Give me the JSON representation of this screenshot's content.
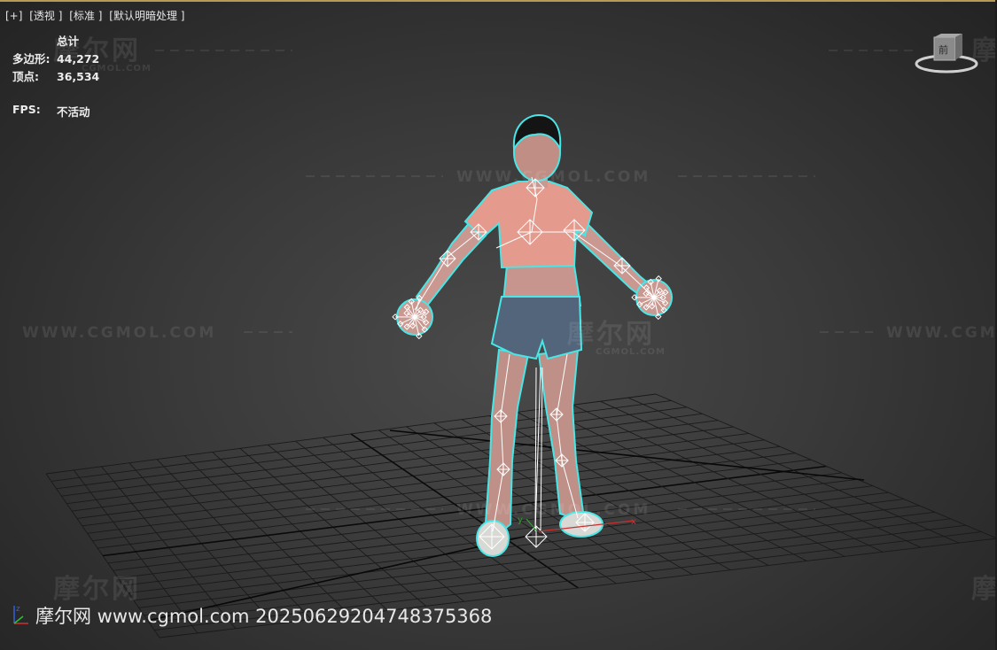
{
  "viewport": {
    "label_plus": "[+]",
    "label_view": "[透视 ]",
    "label_shading": "[标准 ]",
    "label_lighting": "[默认明暗处理 ]"
  },
  "stats": {
    "header": "总计",
    "polygons_label": "多边形:",
    "polygons_value": "44,272",
    "vertices_label": "顶点:",
    "vertices_value": "36,534",
    "fps_label": "FPS:",
    "fps_value": "不活动"
  },
  "watermarks": {
    "url": "WWW.CGMOL.COM",
    "url_short": "WWW.CGM",
    "logo": "摩尔网",
    "logo_small": "CGMOL.COM"
  },
  "caption": "摩尔网 www.cgmol.com 20250629204748375368",
  "viewcube": {
    "face_label": "前"
  },
  "axis_labels": {
    "x": "x",
    "y": "y",
    "z": "z"
  },
  "colors": {
    "selection_outline": "#48e6e6",
    "shirt": "#e49a8c",
    "shorts": "#54657a",
    "skin": "#c99890",
    "hair": "#151515",
    "bones": "#ffffff",
    "grid": "#151515",
    "x_axis": "#c83030"
  }
}
